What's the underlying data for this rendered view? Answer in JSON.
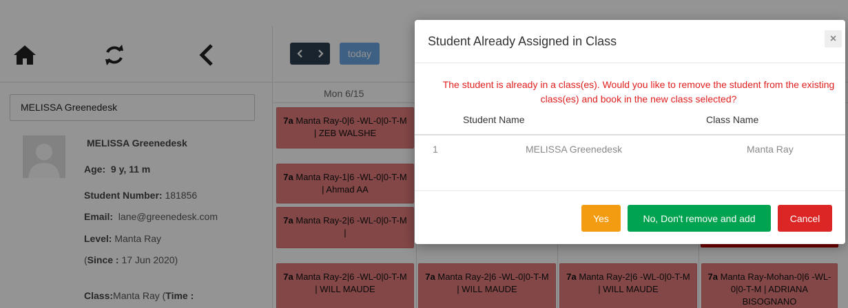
{
  "sidebar": {
    "search_value": "MELISSA Greenedesk",
    "student": {
      "name": "MELISSA Greenedesk",
      "age_label": "Age:",
      "age_value": "9 y, 11 m",
      "number_label": "Student Number:",
      "number_value": "181856",
      "email_label": "Email:",
      "email_value": "lane@greenedesk.com",
      "level_label": "Level:",
      "level_value": "Manta Ray",
      "since_open": "(",
      "since_label": "Since :",
      "since_value": "17 Jun 2020)",
      "class_label": "Class:",
      "class_value": "Manta Ray (",
      "time_label": "Time :"
    }
  },
  "calendar": {
    "today_label": "today",
    "day_header": "Mon 6/15",
    "events": [
      {
        "time": "7a",
        "text": "Manta Ray-0|6 -WL-0|0-T-M | ZEB WALSHE"
      },
      {
        "time": "7a",
        "text": "Manta Ray-1|6 -WL-0|0-T-M | Ahmad AA"
      },
      {
        "time": "7a",
        "text": "Manta Ray-2|6 -WL-0|0-T-M |"
      },
      {
        "time": "7a",
        "text": "Manta Ray-2|6 -WL-0|0-T-M | WILL MAUDE"
      },
      {
        "time": "7a",
        "text": "Manta Ray-2|6 -WL-0|0-T-M | WILL MAUDE"
      },
      {
        "time": "7a",
        "text": "Manta Ray-2|6 -WL-0|0-T-M | WILL MAUDE"
      },
      {
        "time": "7a",
        "text": "Manta Ray-Mohan-0|6 -WL-0|0-T-M | ADRIANA BISOGNANO"
      }
    ]
  },
  "modal": {
    "title": "Student Already Assigned in Class",
    "close": "×",
    "message": "The student is already in a class(es). Would you like to remove the student from the existing class(es) and book in the new class selected?",
    "columns": [
      "Student Name",
      "Class Name"
    ],
    "rows": [
      {
        "index": "1",
        "student": "MELISSA Greenedesk",
        "class": "Manta Ray"
      }
    ],
    "buttons": {
      "yes": "Yes",
      "no": "No, Don't remove and add",
      "cancel": "Cancel"
    }
  },
  "colors": {
    "event": "#e27b7b",
    "event_dark": "#c80000",
    "message": "#e11d1d",
    "yes": "#f39c12",
    "no": "#00a34f",
    "cancel": "#dc2626",
    "today": "#3a87d9"
  }
}
